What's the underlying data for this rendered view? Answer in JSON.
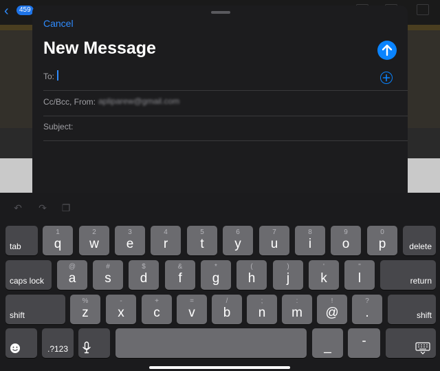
{
  "background": {
    "unread_badge": "459",
    "back_icon": "chevron-left-icon"
  },
  "compose": {
    "cancel_label": "Cancel",
    "title": "New Message",
    "send_icon": "arrow-up-icon",
    "to_label": "To:",
    "cc_label": "Cc/Bcc, From:",
    "from_value": "apliparew@gmail.com",
    "subject_label": "Subject:",
    "add_contact_icon": "plus-circle-icon"
  },
  "keyboard": {
    "shortcuts": {
      "undo_icon": "undo-icon",
      "redo_icon": "redo-icon",
      "paste_icon": "clipboard-icon"
    },
    "row1": {
      "tab": "tab",
      "keys": [
        {
          "main": "q",
          "sub": "1"
        },
        {
          "main": "w",
          "sub": "2"
        },
        {
          "main": "e",
          "sub": "3"
        },
        {
          "main": "r",
          "sub": "4"
        },
        {
          "main": "t",
          "sub": "5"
        },
        {
          "main": "y",
          "sub": "6"
        },
        {
          "main": "u",
          "sub": "7"
        },
        {
          "main": "i",
          "sub": "8"
        },
        {
          "main": "o",
          "sub": "9"
        },
        {
          "main": "p",
          "sub": "0"
        }
      ],
      "delete": "delete"
    },
    "row2": {
      "caps": "caps lock",
      "keys": [
        {
          "main": "a",
          "sub": "@"
        },
        {
          "main": "s",
          "sub": "#"
        },
        {
          "main": "d",
          "sub": "$"
        },
        {
          "main": "f",
          "sub": "&"
        },
        {
          "main": "g",
          "sub": "*"
        },
        {
          "main": "h",
          "sub": "("
        },
        {
          "main": "j",
          "sub": ")"
        },
        {
          "main": "k",
          "sub": "'"
        },
        {
          "main": "l",
          "sub": "\""
        }
      ],
      "return": "return"
    },
    "row3": {
      "shift_left": "shift",
      "keys": [
        {
          "main": "z",
          "sub": "%"
        },
        {
          "main": "x",
          "sub": "-"
        },
        {
          "main": "c",
          "sub": "+"
        },
        {
          "main": "v",
          "sub": "="
        },
        {
          "main": "b",
          "sub": "/"
        },
        {
          "main": "n",
          "sub": ";"
        },
        {
          "main": "m",
          "sub": ":"
        },
        {
          "main": "@",
          "sub": "!"
        },
        {
          "main": ".",
          "sub": "?"
        }
      ],
      "shift_right": "shift"
    },
    "row4": {
      "emoji_icon": "emoji-icon",
      "numbers": ".?123",
      "mic_icon": "microphone-icon",
      "underscore": "_",
      "dash": "-",
      "dismiss_icon": "keyboard-dismiss-icon"
    }
  },
  "colors": {
    "accent": "#0a84ff",
    "sheet": "#1c1c1e",
    "key": "#6b6b6f",
    "function_key": "#47474b"
  }
}
